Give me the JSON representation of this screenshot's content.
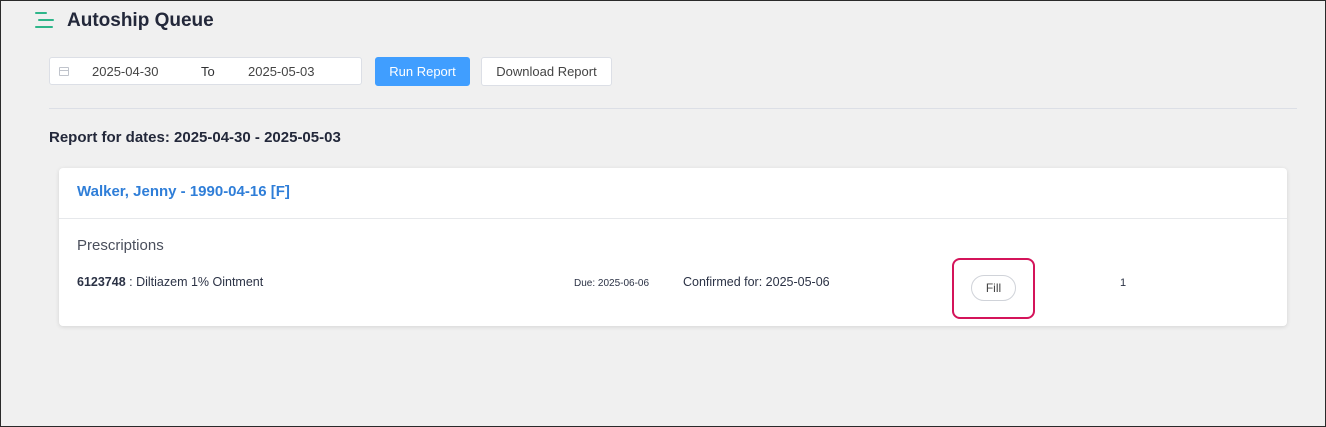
{
  "header": {
    "title": "Autoship Queue",
    "menu_icon": "hamburger-menu-icon",
    "accent_color": "#2eb68a"
  },
  "filters": {
    "start_date": "2025-04-30",
    "separator": "To",
    "end_date": "2025-05-03",
    "calendar_icon": "calendar-icon",
    "run_label": "Run Report",
    "download_label": "Download Report",
    "primary_color": "#409eff"
  },
  "report": {
    "heading": "Report for dates: 2025-04-30 - 2025-05-03",
    "patients": [
      {
        "name": "Walker, Jenny - 1990-04-16 [F]",
        "section_label": "Prescriptions",
        "prescriptions": [
          {
            "rx_number": "6123748",
            "description": " : Diltiazem 1% Ointment",
            "due": "Due: 2025-06-06",
            "confirmed": "Confirmed for: 2025-05-06",
            "action_label": "Fill",
            "quantity": "1"
          }
        ]
      }
    ]
  },
  "annotation": {
    "highlight_color": "#d4145a"
  }
}
